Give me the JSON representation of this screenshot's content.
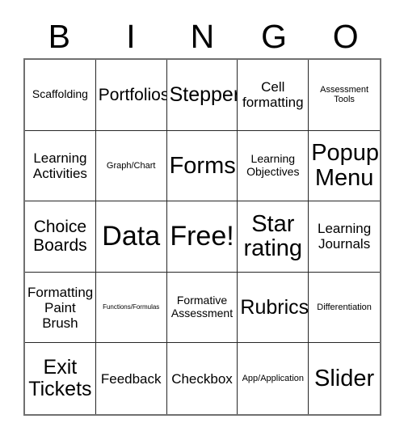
{
  "card": {
    "title": "BINGO",
    "header_letters": [
      "B",
      "I",
      "N",
      "G",
      "O"
    ],
    "grid_columns": 5,
    "grid_rows": 5,
    "colors": {
      "background": "#ffffff",
      "text": "#000000",
      "outer_border": "#707070",
      "inner_border": "#262626"
    },
    "free_space": {
      "row": 3,
      "column": 3,
      "label": "Free!"
    },
    "rows": [
      [
        {
          "label": "Scaffolding",
          "size": "md"
        },
        {
          "label": "Portfolios",
          "size": "xl"
        },
        {
          "label": "Stepper",
          "size": "2xl"
        },
        {
          "label": "Cell formatting",
          "size": "lg"
        },
        {
          "label": "Assessment Tools",
          "size": "sm"
        }
      ],
      [
        {
          "label": "Learning Activities",
          "size": "lg"
        },
        {
          "label": "Graph/Chart",
          "size": "sm"
        },
        {
          "label": "Forms",
          "size": "3xl"
        },
        {
          "label": "Learning Objectives",
          "size": "md"
        },
        {
          "label": "Popup Menu",
          "size": "3xl"
        }
      ],
      [
        {
          "label": "Choice Boards",
          "size": "xl"
        },
        {
          "label": "Data",
          "size": "4xl"
        },
        {
          "label": "Free!",
          "size": "4xl"
        },
        {
          "label": "Star rating",
          "size": "3xl"
        },
        {
          "label": "Learning Journals",
          "size": "lg"
        }
      ],
      [
        {
          "label": "Formatting Paint Brush",
          "size": "lg"
        },
        {
          "label": "Functions/Formulas",
          "size": "xs"
        },
        {
          "label": "Formative Assessment",
          "size": "md"
        },
        {
          "label": "Rubrics",
          "size": "2xl"
        },
        {
          "label": "Differentiation",
          "size": "sm"
        }
      ],
      [
        {
          "label": "Exit Tickets",
          "size": "2xl"
        },
        {
          "label": "Feedback",
          "size": "lg"
        },
        {
          "label": "Checkbox",
          "size": "lg"
        },
        {
          "label": "App/Application",
          "size": "sm"
        },
        {
          "label": "Slider",
          "size": "3xl"
        }
      ]
    ]
  }
}
